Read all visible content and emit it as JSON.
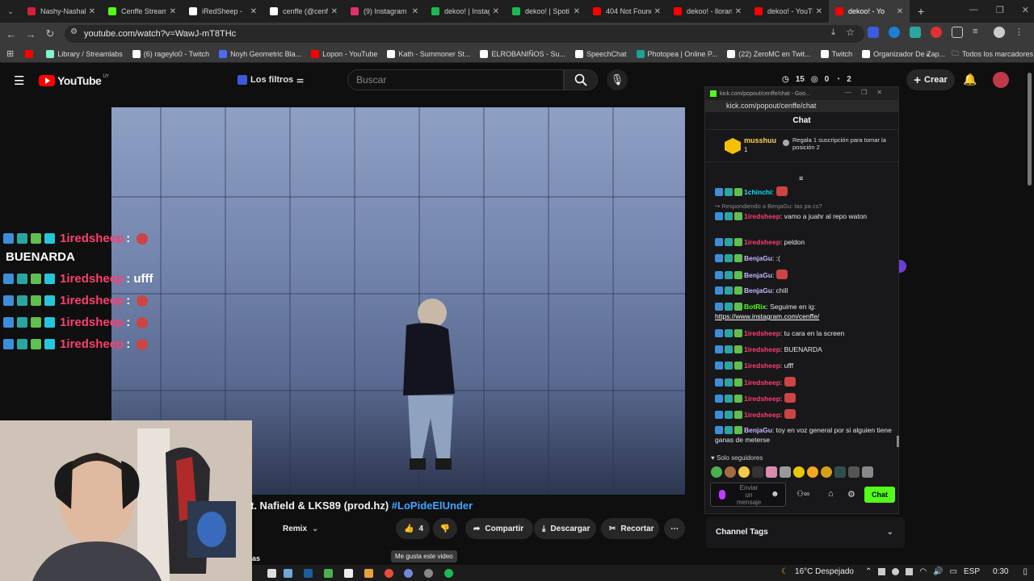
{
  "browser": {
    "tabs": [
      {
        "label": "Nashy-Nashal",
        "color": "#d2213a"
      },
      {
        "label": "Cenffe Stream",
        "color": "#53fc18"
      },
      {
        "label": "iRedSheep -",
        "color": "#ffffff"
      },
      {
        "label": "cenffe (@cenff",
        "color": "#ffffff"
      },
      {
        "label": "(9) Instagram",
        "color": "#e1306c"
      },
      {
        "label": "dekoo! | Instag",
        "color": "#1db954"
      },
      {
        "label": "dekoo! | Spoti",
        "color": "#1db954"
      },
      {
        "label": "404 Not Found",
        "color": "#ff0000"
      },
      {
        "label": "dekoo! - lloran",
        "color": "#ff0000"
      },
      {
        "label": "dekoo! - YouTu",
        "color": "#ff0000"
      },
      {
        "label": "dekoo! - Yo",
        "color": "#ff0000",
        "active": true
      }
    ],
    "new_tab": "+",
    "url": "youtube.com/watch?v=WawJ-mT8THc",
    "bookmarks": [
      {
        "label": "",
        "color": "#ff0000"
      },
      {
        "label": "Library / Streamlabs",
        "color": "#80f5d2"
      },
      {
        "label": "(6) rageylo0 - Twitch",
        "color": "#ffffff"
      },
      {
        "label": "Noyh Geometric Bla...",
        "color": "#4a6cf7"
      },
      {
        "label": "Lopon - YouTube",
        "color": "#ff0000"
      },
      {
        "label": "Kath - Summoner St...",
        "color": "#ffffff"
      },
      {
        "label": "ELROBANIÑOS - Su...",
        "color": "#ffffff"
      },
      {
        "label": "SpeechChat",
        "color": "#ffffff"
      },
      {
        "label": "Photopea | Online P...",
        "color": "#18a497"
      },
      {
        "label": "(22) ZeroMC en Twit...",
        "color": "#ffffff"
      },
      {
        "label": "Twitch",
        "color": "#ffffff"
      },
      {
        "label": "Organizador De Zap...",
        "color": "#ffffff"
      }
    ],
    "all_bookmarks": "Todos los marcadores"
  },
  "youtube": {
    "logo_text": "YouTube",
    "logo_country": "UY",
    "filters_label": "Los filtros",
    "search_placeholder": "Buscar",
    "stats": [
      "15",
      "0",
      "2"
    ],
    "create_label": "Crear",
    "video_title": "t. Nafield & LKS89 (prod.hz)",
    "video_hashtag": "#LoPideElUnder",
    "remix_label": "Remix",
    "like_count": "4",
    "share_label": "Compartir",
    "download_label": "Descargar",
    "clip_label": "Recortar",
    "like_tooltip": "Me gusta este video",
    "below_text": "as"
  },
  "overlay_chat": [
    {
      "user": "1iredsheep",
      "msg": ":"
    },
    {
      "user": "",
      "msg": "BUENARDA"
    },
    {
      "user": "1iredsheep",
      "msg": ": ufff"
    },
    {
      "user": "1iredsheep",
      "msg": ":"
    },
    {
      "user": "1iredsheep",
      "msg": ":"
    },
    {
      "user": "1iredsheep",
      "msg": ":"
    }
  ],
  "kick_chat": {
    "window_title": "kick.com/popout/cenffe/chat - Goo...",
    "url": "kick.com/popout/cenffe/chat",
    "header": "Chat",
    "pinned_user": "musshuu",
    "pinned_rank": "1",
    "pinned_gift": "Regala 1 suscripción para tomar la posición 2",
    "messages": [
      {
        "user": "1chinchi",
        "text": ":",
        "color": "#00e5ff"
      },
      {
        "reply": "Respondiendo a BenjaGu: tas pa cs?"
      },
      {
        "user": "1iredsheep",
        "text": ": vamo a juahr al repo waton",
        "color": "#ff3d6e"
      },
      {
        "user": "1iredsheep",
        "text": ": peldon",
        "color": "#ff3d6e"
      },
      {
        "user": "BenjaGu",
        "text": ": :(",
        "color": "#c8b6ff"
      },
      {
        "user": "BenjaGu",
        "text": ":",
        "color": "#c8b6ff"
      },
      {
        "user": "BenjaGu",
        "text": ": chill",
        "color": "#c8b6ff"
      },
      {
        "user": "BotRix",
        "text": ": Seguime en ig:",
        "color": "#53fc18",
        "link": "https://www.instagram.com/cenffe/"
      },
      {
        "user": "1iredsheep",
        "text": ": tu cara en la screen",
        "color": "#ff3d6e"
      },
      {
        "user": "1iredsheep",
        "text": ": BUENARDA",
        "color": "#ff3d6e"
      },
      {
        "user": "1iredsheep",
        "text": ": ufff",
        "color": "#ff3d6e"
      },
      {
        "user": "1iredsheep",
        "text": ":",
        "color": "#ff3d6e"
      },
      {
        "user": "1iredsheep",
        "text": ":",
        "color": "#ff3d6e"
      },
      {
        "user": "1iredsheep",
        "text": ":",
        "color": "#ff3d6e"
      },
      {
        "user": "BenjaGu",
        "text": ": toy en voz general por si alguien tiene ganas de meterse",
        "color": "#c8b6ff"
      }
    ],
    "followers_only": "Solo seguidores",
    "input_placeholder": "Enviar un mensaje",
    "send_label": "Chat",
    "channel_tags": "Channel Tags"
  },
  "taskbar": {
    "weather": "16°C Despejado",
    "lang": "ESP",
    "time": "0:30"
  }
}
